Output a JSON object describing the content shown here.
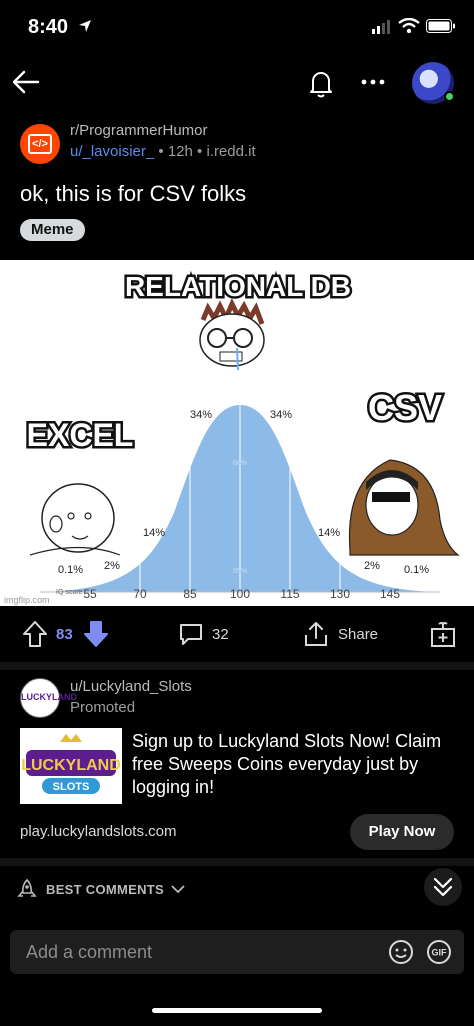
{
  "status_bar": {
    "time": "8:40"
  },
  "post": {
    "subreddit": "r/ProgrammerHumor",
    "author": "u/_lavoisier_",
    "age": "12h",
    "domain": "i.redd.it",
    "title": "ok, this is for CSV folks",
    "flair": "Meme",
    "meme": {
      "top_label": "RELATIONAL DB",
      "left_label": "EXCEL",
      "right_label": "CSV",
      "percents": [
        "0.1%",
        "2%",
        "14%",
        "34%",
        "34%",
        "14%",
        "2%",
        "0.1%"
      ],
      "inner_labels": [
        "68%",
        "95%"
      ],
      "x_axis_title": "IQ score",
      "ticks": [
        "55",
        "70",
        "85",
        "100",
        "115",
        "130",
        "145"
      ],
      "watermark": "imgflip.com"
    }
  },
  "actions": {
    "score": "83",
    "comments": "32",
    "share_label": "Share"
  },
  "promoted": {
    "user": "u/Luckyland_Slots",
    "tag": "Promoted",
    "logo_text": "LUCKYLAND",
    "image_text_1": "LUCKYLAND",
    "image_text_2": "SLOTS",
    "text": "Sign up to Luckyland Slots Now! Claim free Sweeps Coins everyday just by logging in!",
    "url": "play.luckylandslots.com",
    "cta": "Play Now"
  },
  "comments": {
    "sort_label": "BEST COMMENTS",
    "placeholder": "Add a comment"
  },
  "colors": {
    "accent_blue": "#7e8cf5",
    "subreddit_orange": "#ff4500",
    "username_blue": "#5a8dee",
    "curve_blue": "#8cbbe8"
  }
}
